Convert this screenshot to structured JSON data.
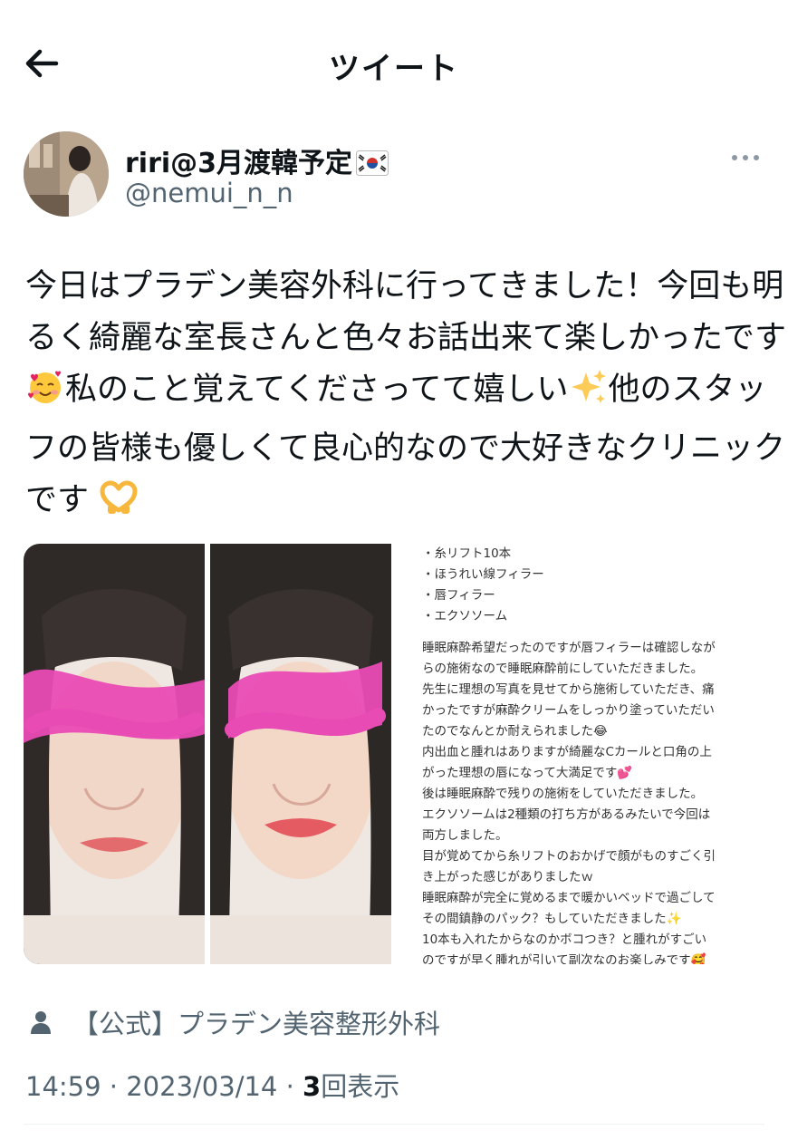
{
  "header": {
    "title": "ツイート"
  },
  "user": {
    "display_name": "riri@3月渡韓予定",
    "handle": "@nemui_n_n"
  },
  "tweet": {
    "lines": [
      "今日はプラデン美容外科に行ってきました！今回も明",
      "るく綺麗な室長さんと色々お話出来て楽しかったです",
      "私のこと覚えてくださってて嬉しい",
      "他のスタッ",
      "フの皆様も優しくて良心的なので大好きなクリニック",
      "です"
    ]
  },
  "media": {
    "notes": [
      "・糸リフト10本",
      "・ほうれい線フィラー",
      "・唇フィラー",
      "・エクソソーム",
      "",
      "睡眠麻酔希望だったのですが唇フィラーは確認しなが",
      "らの施術なので睡眠麻酔前にしていただきました。",
      "先生に理想の写真を見せてから施術していただき、痛",
      "かったですが麻酔クリームをしっかり塗っていただい",
      "たのでなんとか耐えられました😂",
      "内出血と腫れはありますが綺麗なCカールと口角の上",
      "がった理想の唇になって大満足です💕",
      "後は睡眠麻酔で残りの施術をしていただきました。",
      "エクソソームは2種類の打ち方があるみたいで今回は",
      "両方しました。",
      "目が覚めてから糸リフトのおかげで顔がものすごく引",
      "き上がった感じがありましたｗ",
      "睡眠麻酔が完全に覚めるまで暖かいベッドで過ごして",
      "その間鎮静のパック？もしていただきました✨",
      "10本も入れたからなのかボコつき？と腫れがすごい",
      "のですが早く腫れが引いて副次なのお楽しみです🥰"
    ]
  },
  "footer": {
    "source": "【公式】プラデン美容整形外科",
    "time": "14:59",
    "date": "2023/03/14",
    "separator": " · ",
    "views_count": "3",
    "views_label": "回表示"
  },
  "colors": {
    "text": "#0f1419",
    "secondary": "#536471",
    "blur_pink": "#e94bb5"
  },
  "icons": [
    "back-arrow-icon",
    "korea-flag-icon",
    "more-icon",
    "smiling-hearts-emoji",
    "sparkles-emoji",
    "heart-hands-emoji",
    "person-icon"
  ]
}
